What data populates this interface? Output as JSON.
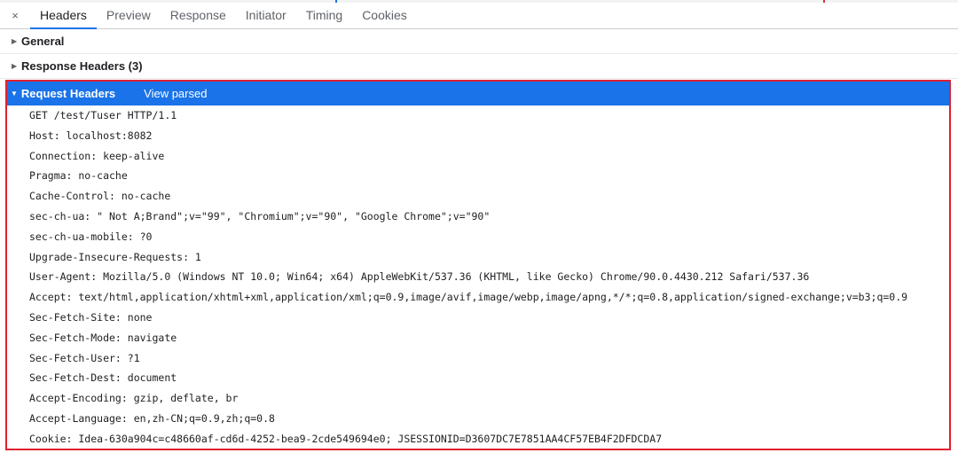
{
  "tabs": {
    "close": "×",
    "items": [
      "Headers",
      "Preview",
      "Response",
      "Initiator",
      "Timing",
      "Cookies"
    ],
    "active": "Headers"
  },
  "sections": {
    "general": "General",
    "response_headers": "Response Headers (3)",
    "request_headers": "Request Headers",
    "view_parsed": "View parsed"
  },
  "request_lines": [
    "GET /test/Tuser HTTP/1.1",
    "Host: localhost:8082",
    "Connection: keep-alive",
    "Pragma: no-cache",
    "Cache-Control: no-cache",
    "sec-ch-ua: \" Not A;Brand\";v=\"99\", \"Chromium\";v=\"90\", \"Google Chrome\";v=\"90\"",
    "sec-ch-ua-mobile: ?0",
    "Upgrade-Insecure-Requests: 1",
    "User-Agent: Mozilla/5.0 (Windows NT 10.0; Win64; x64) AppleWebKit/537.36 (KHTML, like Gecko) Chrome/90.0.4430.212 Safari/537.36",
    "Accept: text/html,application/xhtml+xml,application/xml;q=0.9,image/avif,image/webp,image/apng,*/*;q=0.8,application/signed-exchange;v=b3;q=0.9",
    "Sec-Fetch-Site: none",
    "Sec-Fetch-Mode: navigate",
    "Sec-Fetch-User: ?1",
    "Sec-Fetch-Dest: document",
    "Accept-Encoding: gzip, deflate, br",
    "Accept-Language: en,zh-CN;q=0.9,zh;q=0.8",
    "Cookie: Idea-630a904c=c48660af-cd6d-4252-bea9-2cde549694e0; JSESSIONID=D3607DC7E7851AA4CF57EB4F2DFDCDA7"
  ],
  "colors": {
    "accent": "#1a73e8",
    "highlight_box": "#e02030"
  }
}
